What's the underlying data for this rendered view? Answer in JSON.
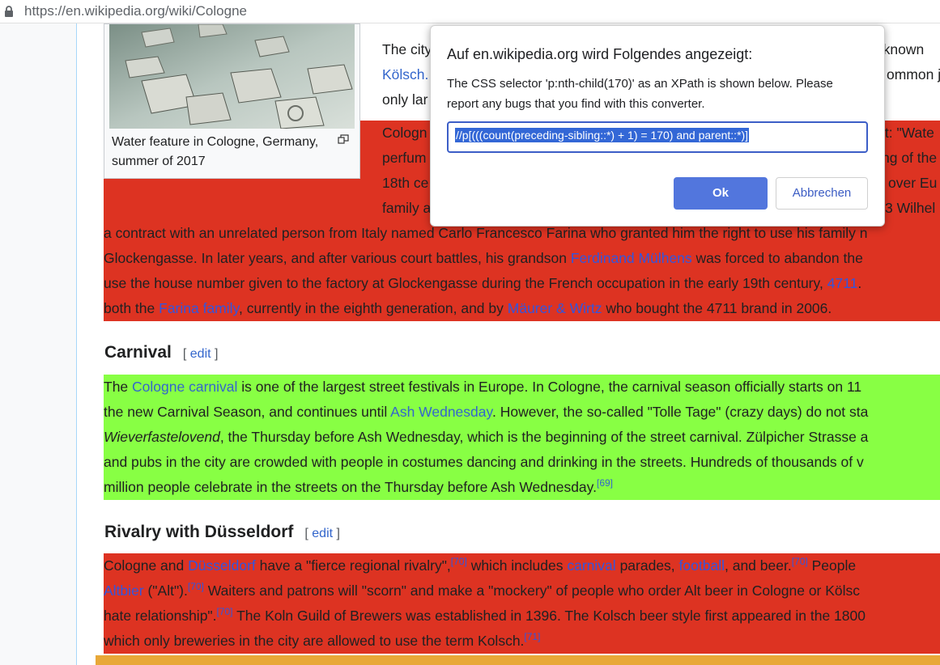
{
  "browser": {
    "url": "https://en.wikipedia.org/wiki/Cologne"
  },
  "figure": {
    "caption": "Water feature in Cologne, Germany, summer of 2017"
  },
  "intro": {
    "l1": "The city",
    "l1r": "ll known",
    "l2": "Kölsch.",
    "l2r": "ommon je",
    "l3": "only lar"
  },
  "perfume": {
    "l1a": "Cologn",
    "l1b": "it: \"Wate",
    "l2a": "perfum",
    "l2b": "ng of the",
    "l3a": "18th ce",
    "l3b": "over Eu",
    "l4a": "family a",
    "l4b": "3 Wilhel",
    "l5": "a contract with an unrelated person from Italy named Carlo Francesco Farina who granted him the right to use his family n",
    "l6a": "Glockengasse. In later years, and after various court battles, his grandson",
    "l6link": "Ferdinand Mülhens",
    "l6b": "was forced to abandon the",
    "l7a": "use the house number given to the factory at Glockengasse during the French occupation in the early 19th century,",
    "l7link": "4711",
    "l7b": ".",
    "l8a": "both the",
    "l8link1": "Farina family",
    "l8b": ", currently in the eighth generation, and by",
    "l8link2": "Mäurer & Wirtz",
    "l8c": "who bought the 4711 brand in 2006."
  },
  "carnival": {
    "heading": "Carnival",
    "edit": "edit",
    "l1a": "The",
    "l1link": "Cologne carnival",
    "l1b": "is one of the largest street festivals in Europe. In Cologne, the carnival season officially starts on 11",
    "l2a": "the new Carnival Season, and continues until",
    "l2link": "Ash Wednesday",
    "l2b": ". However, the so-called \"Tolle Tage\" (crazy days) do not sta",
    "l3em": "Wieverfastelovend",
    "l3b": ", the Thursday before Ash Wednesday, which is the beginning of the street carnival. Zülpicher Strasse a",
    "l4": "and pubs in the city are crowded with people in costumes dancing and drinking in the streets. Hundreds of thousands of v",
    "l5": "million people celebrate in the streets on the Thursday before Ash Wednesday.",
    "l5ref": "[69]"
  },
  "rivalry": {
    "heading": "Rivalry with Düsseldorf",
    "edit": "edit",
    "l1a": "Cologne and",
    "l1link1": "Düsseldorf",
    "l1b": "have a \"fierce regional rivalry\",",
    "l1ref1": "[70]",
    "l1c": "which includes",
    "l1link2": "carnival",
    "l1d": "parades,",
    "l1link3": "football",
    "l1e": ", and beer.",
    "l1ref2": "[70]",
    "l1f": "People",
    "l2link": "Altbier",
    "l2a": "(\"Alt\").",
    "l2ref": "[70]",
    "l2b": "Waiters and patrons will \"scorn\" and make a \"mockery\" of people who order Alt beer in Cologne or Kölsc",
    "l3a": "hate relationship\".",
    "l3ref": "[70]",
    "l3b": "The Koln Guild of Brewers was established in 1396. The Kolsch beer style first appeared in the 1800",
    "l4a": "which only breweries in the city are allowed to use the term Kolsch.",
    "l4ref": "[71]"
  },
  "dialog": {
    "title": "Auf en.wikipedia.org wird Folgendes angezeigt:",
    "message": "The CSS selector 'p:nth-child(170)' as an XPath is shown below.  Please report any bugs that you find with this converter.",
    "input_value": "//p[(((count(preceding-sibling::*) + 1) = 170) and parent::*)]",
    "ok_label": "Ok",
    "cancel_label": "Abbrechen"
  }
}
